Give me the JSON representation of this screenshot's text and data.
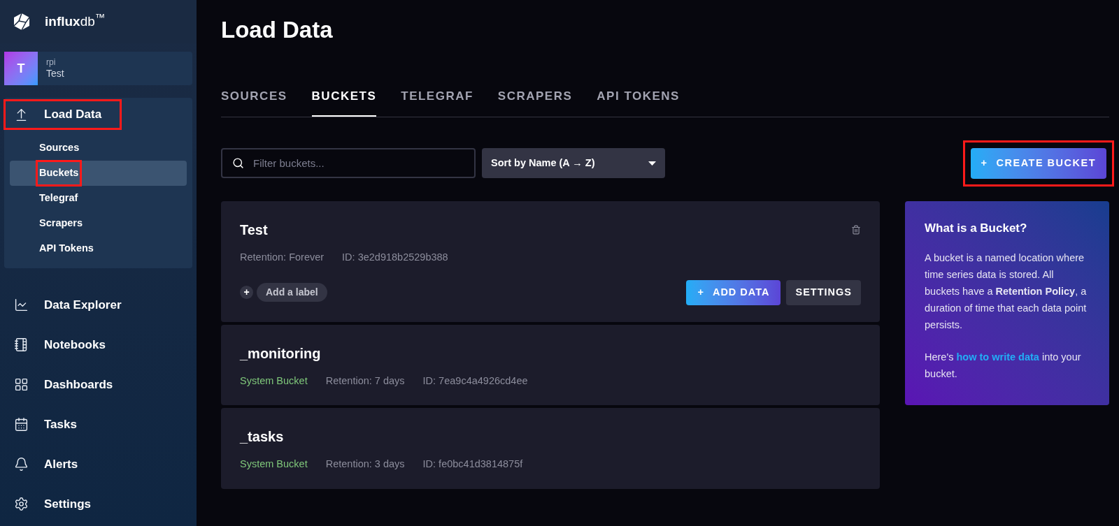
{
  "brand": {
    "logo_text": "**influx**db$^{™}$"
  },
  "org": {
    "avatar": "T",
    "name": "rpi",
    "bucket": "Test"
  },
  "nav": [
    {
      "label": "Load Data",
      "expanded": true,
      "highlighted": true,
      "children": [
        {
          "label": "Sources",
          "selected": false,
          "highlighted": false
        },
        {
          "label": "Buckets",
          "selected": true,
          "highlighted": true
        },
        {
          "label": "Telegraf",
          "selected": false,
          "highlighted": false
        },
        {
          "label": "Scrapers",
          "selected": false,
          "highlighted": false
        },
        {
          "label": "API Tokens",
          "selected": false,
          "highlighted": false
        }
      ]
    },
    {
      "label": "Data Explorer",
      "expanded": false,
      "highlighted": false
    },
    {
      "label": "Notebooks",
      "expanded": false,
      "highlighted": false
    },
    {
      "label": "Dashboards",
      "expanded": false,
      "highlighted": false
    },
    {
      "label": "Tasks",
      "expanded": false,
      "highlighted": false
    },
    {
      "label": "Alerts",
      "expanded": false,
      "highlighted": false
    },
    {
      "label": "Settings",
      "expanded": false,
      "highlighted": false
    }
  ],
  "page_title": "Load Data",
  "tabs": [
    {
      "label": "SOURCES",
      "selected": false
    },
    {
      "label": "BUCKETS",
      "selected": true
    },
    {
      "label": "TELEGRAF",
      "selected": false
    },
    {
      "label": "SCRAPERS",
      "selected": false
    },
    {
      "label": "API TOKENS",
      "selected": false
    }
  ],
  "filter": {
    "placeholder": "Filter buckets..."
  },
  "sort": {
    "value": "Sort by Name (A → Z)"
  },
  "create_button": {
    "label": "CREATE BUCKET",
    "icon": "+",
    "highlighted": true
  },
  "buckets": [
    {
      "name": "Test",
      "retention": "Retention: Forever",
      "id": "ID: 3e2d918b2529b388",
      "deletable": true,
      "add_label": "Add a label",
      "add_label_icon": "+",
      "add_data": "ADD DATA",
      "add_data_icon": "+",
      "settings": "SETTINGS"
    },
    {
      "name": "_monitoring",
      "system_tag": "System Bucket",
      "retention": "Retention: 7 days",
      "id": "ID: 7ea9c4a4926cd4ee",
      "deletable": false
    },
    {
      "name": "_tasks",
      "system_tag": "System Bucket",
      "retention": "Retention: 3 days",
      "id": "ID: fe0bc41d3814875f",
      "deletable": false
    }
  ],
  "info": {
    "title": "What is a Bucket?",
    "paragraphs": [
      {
        "text": "A bucket is a named location where time series data is stored. All buckets have a **Retention Policy**, a duration of time that each data point persists."
      },
      {
        "before": "Here's",
        "link": "how to write data",
        "after": "into your bucket."
      }
    ]
  }
}
